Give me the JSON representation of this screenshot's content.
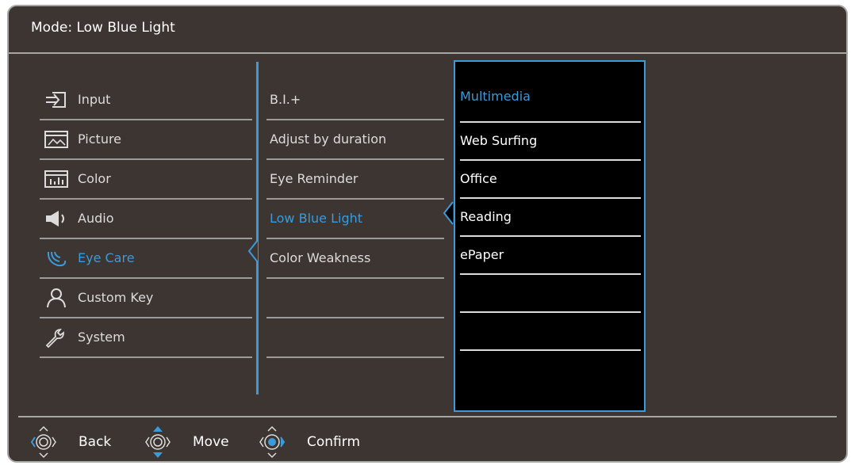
{
  "header": {
    "title": "Mode: Low Blue Light"
  },
  "menu_level1": {
    "items": [
      {
        "label": "Input",
        "icon": "input-icon"
      },
      {
        "label": "Picture",
        "icon": "picture-icon"
      },
      {
        "label": "Color",
        "icon": "color-icon"
      },
      {
        "label": "Audio",
        "icon": "speaker-icon"
      },
      {
        "label": "Eye Care",
        "icon": "eye-care-icon",
        "active": true
      },
      {
        "label": "Custom Key",
        "icon": "user-icon"
      },
      {
        "label": "System",
        "icon": "wrench-icon"
      }
    ]
  },
  "menu_level2": {
    "items": [
      {
        "label": "B.I.+"
      },
      {
        "label": "Adjust by duration"
      },
      {
        "label": "Eye Reminder"
      },
      {
        "label": "Low Blue Light",
        "active": true
      },
      {
        "label": "Color Weakness"
      },
      {
        "label": ""
      },
      {
        "label": ""
      }
    ]
  },
  "menu_level3": {
    "items": [
      {
        "label": "Multimedia",
        "active": true
      },
      {
        "label": "Web Surfing"
      },
      {
        "label": "Office"
      },
      {
        "label": "Reading"
      },
      {
        "label": "ePaper"
      },
      {
        "label": ""
      },
      {
        "label": ""
      },
      {
        "label": ""
      }
    ]
  },
  "footer": {
    "back_label": "Back",
    "move_label": "Move",
    "confirm_label": "Confirm"
  },
  "colors": {
    "accent": "#3b9ad9",
    "panel": "#3d3532",
    "text": "#dcdcdc"
  }
}
